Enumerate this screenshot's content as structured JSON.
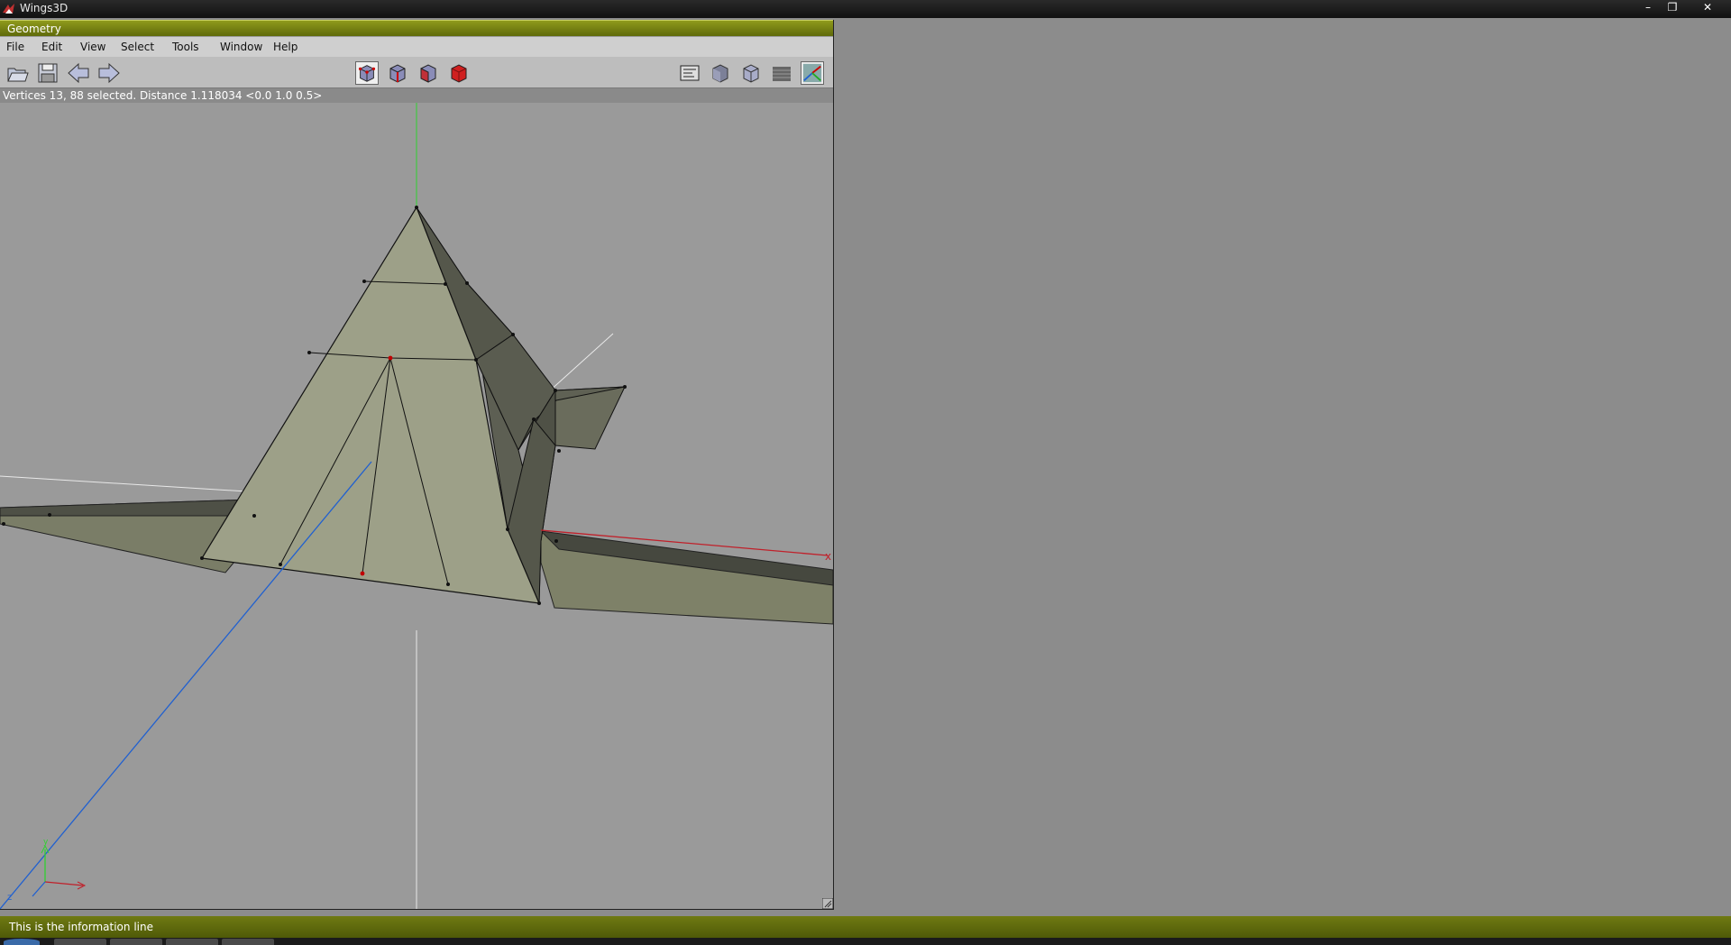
{
  "window": {
    "title": "Wings3D",
    "controls": {
      "minimize": "–",
      "restore": "❐",
      "close": "✕"
    }
  },
  "geometry": {
    "title": "Geometry",
    "menus": [
      "File",
      "Edit",
      "View",
      "Select",
      "Tools",
      "Window",
      "Help"
    ],
    "toolbar": {
      "left": [
        "open-icon",
        "save-icon",
        "undo-arrow-icon",
        "redo-arrow-icon"
      ],
      "select_modes": [
        "vertex-mode-icon",
        "edge-mode-icon",
        "face-mode-icon",
        "body-mode-icon"
      ],
      "active_select_mode": "vertex-mode-icon",
      "right": [
        "outliner-icon",
        "smooth-shade-icon",
        "flat-shade-icon",
        "ground-plane-icon",
        "axes-icon"
      ],
      "active_right": "axes-icon"
    },
    "status": "Vertices 13, 88 selected. Distance 1.118034 <0.0 1.0 0.5>",
    "axis_labels": {
      "x": "x",
      "y": "y",
      "z": "z"
    }
  },
  "info_line": "This is the information line",
  "colors": {
    "title_green": "#7a8514",
    "model_face_light": "#9da088",
    "model_face_dark": "#5f6152",
    "x_axis": "#c0202a",
    "y_axis": "#2aa82a",
    "z_axis": "#2060d0",
    "selected_vertex": "#c00000"
  }
}
